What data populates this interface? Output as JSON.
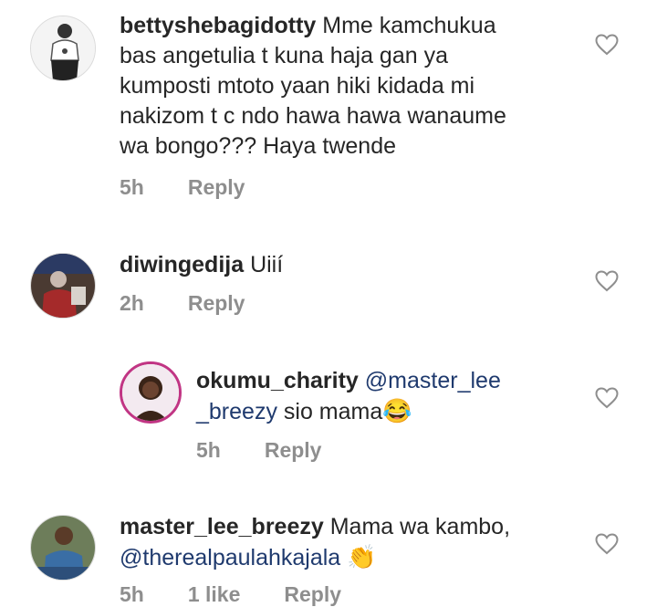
{
  "comments": [
    {
      "username": "bettyshebagidotty",
      "text_lines": [
        "Mme kamchukua",
        "bas angetulia t kuna haja gan ya",
        "kumposti mtoto yaan hiki kidada mi",
        "nakizom t c ndo hawa hawa wanaume",
        "wa bongo??? Haya twende"
      ],
      "time": "5h",
      "reply": "Reply"
    },
    {
      "username": "diwingedija",
      "text": "Uiií",
      "time": "2h",
      "reply": "Reply"
    },
    {
      "username": "okumu_charity",
      "mention_part1": "@master_lee",
      "mention_part2": "_breezy",
      "text": " sio mama",
      "emoji": "😂",
      "time": "5h",
      "reply": "Reply"
    },
    {
      "username": "master_lee_breezy",
      "text": "Mama wa kambo,",
      "mention": "@therealpaulahkajala",
      "emoji": "👏",
      "time": "5h",
      "likes": "1 like",
      "reply": "Reply"
    }
  ],
  "icons": {
    "like": "heart-outline-icon"
  }
}
